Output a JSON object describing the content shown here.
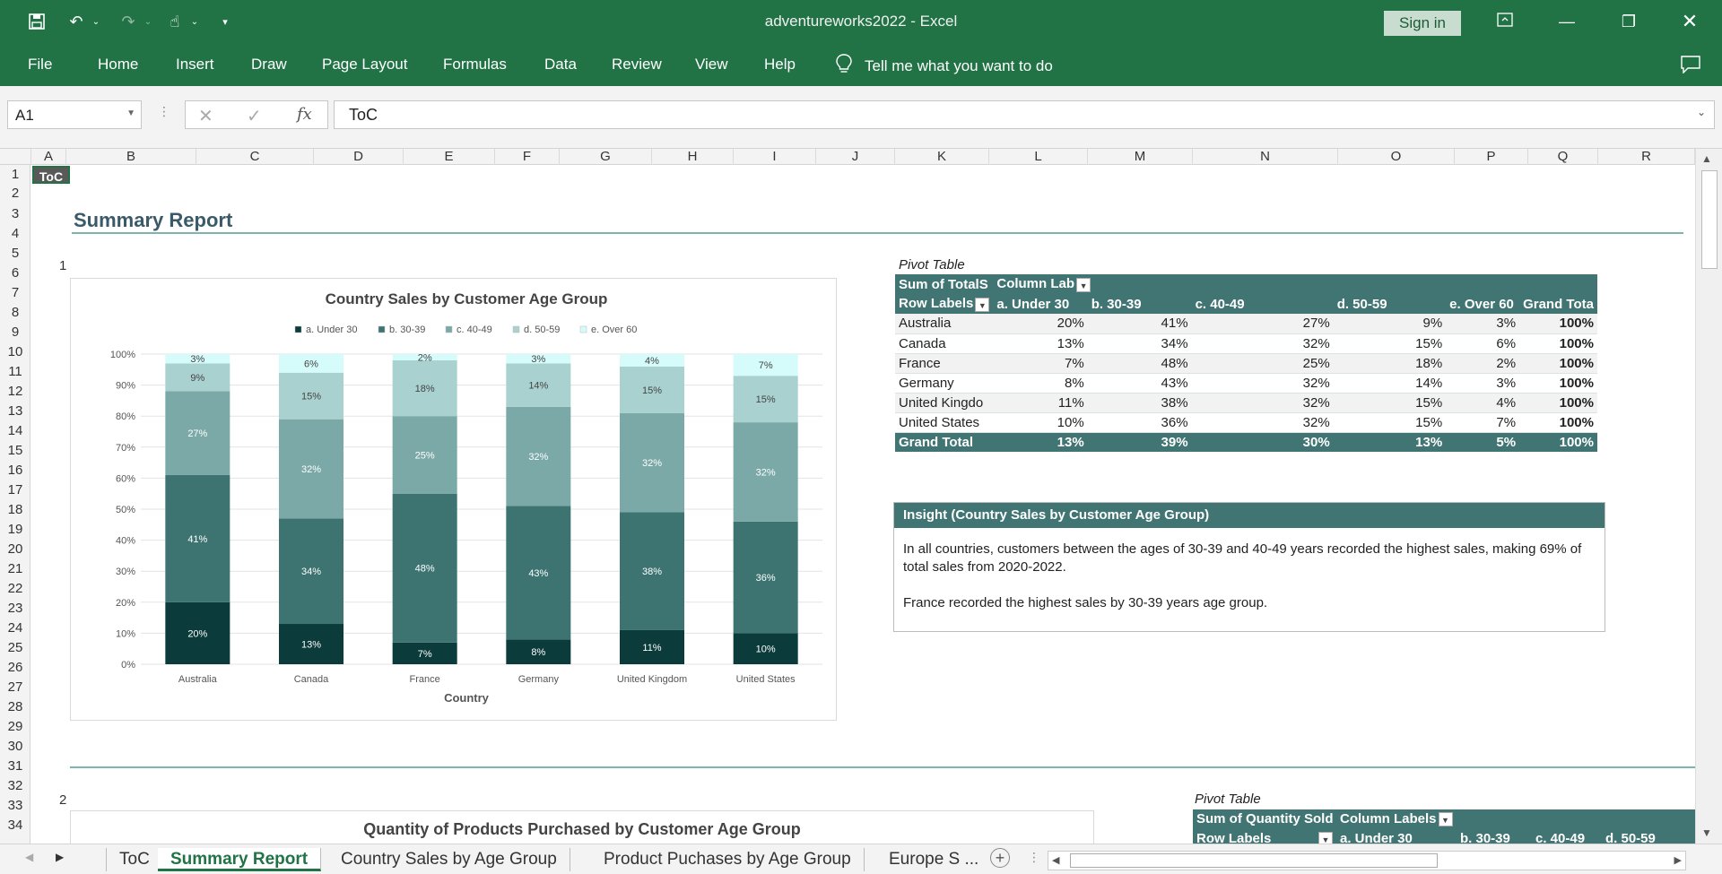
{
  "window": {
    "title": "adventureworks2022  -  Excel",
    "sign_in": "Sign in"
  },
  "ribbon": {
    "tabs": [
      "File",
      "Home",
      "Insert",
      "Draw",
      "Page Layout",
      "Formulas",
      "Data",
      "Review",
      "View",
      "Help"
    ],
    "tell_me": "Tell me what you want to do"
  },
  "formula_bar": {
    "name_box": "A1",
    "fx": "fx",
    "value": "ToC"
  },
  "columns": [
    "A",
    "B",
    "C",
    "D",
    "E",
    "F",
    "G",
    "H",
    "I",
    "J",
    "K",
    "L",
    "M",
    "N",
    "O",
    "P",
    "Q",
    "R"
  ],
  "rows": [
    1,
    2,
    3,
    4,
    5,
    6,
    7,
    8,
    9,
    10,
    11,
    12,
    13,
    14,
    15,
    16,
    17,
    18,
    19,
    20,
    21,
    22,
    23,
    24,
    25,
    26,
    27,
    28,
    29,
    30,
    31,
    32,
    33,
    34
  ],
  "sheet": {
    "toc_cell": "ToC",
    "title": "Summary Report",
    "section1": "1",
    "section2": "2",
    "chart2_title": "Quantity of Products Purchased by Customer Age Group"
  },
  "chart_data": {
    "type": "bar",
    "stacked": true,
    "title": "Country Sales by Customer Age Group",
    "xlabel": "Country",
    "ylabel": "",
    "ylim": [
      0,
      100
    ],
    "yticks": [
      "0%",
      "10%",
      "20%",
      "30%",
      "40%",
      "50%",
      "60%",
      "70%",
      "80%",
      "90%",
      "100%"
    ],
    "legend_position": "top",
    "categories": [
      "Australia",
      "Canada",
      "France",
      "Germany",
      "United Kingdom",
      "United States"
    ],
    "series": [
      {
        "name": "a. Under 30",
        "color": "#0b3b3a",
        "values": [
          20,
          13,
          7,
          8,
          11,
          10
        ]
      },
      {
        "name": "b. 30-39",
        "color": "#3d7472",
        "values": [
          41,
          34,
          48,
          43,
          38,
          36
        ]
      },
      {
        "name": "c. 40-49",
        "color": "#7aa9a7",
        "values": [
          27,
          32,
          25,
          32,
          32,
          32
        ]
      },
      {
        "name": "d. 50-59",
        "color": "#a9d1cf",
        "values": [
          9,
          15,
          18,
          14,
          15,
          15
        ]
      },
      {
        "name": "e. Over 60",
        "color": "#d5fbfa",
        "values": [
          3,
          6,
          2,
          3,
          4,
          7
        ]
      }
    ]
  },
  "pivot1": {
    "caption": "Pivot Table",
    "header1": [
      "Sum of  TotalS",
      "Column Lab"
    ],
    "header2": [
      "Row Labels",
      "a. Under 30",
      "b. 30-39",
      "c. 40-49",
      "d. 50-59",
      "e. Over 60",
      "Grand Tota"
    ],
    "rows": [
      [
        "Australia",
        "20%",
        "41%",
        "27%",
        "9%",
        "3%",
        "100%"
      ],
      [
        "Canada",
        "13%",
        "34%",
        "32%",
        "15%",
        "6%",
        "100%"
      ],
      [
        "France",
        "7%",
        "48%",
        "25%",
        "18%",
        "2%",
        "100%"
      ],
      [
        "Germany",
        "8%",
        "43%",
        "32%",
        "14%",
        "3%",
        "100%"
      ],
      [
        "United Kingdo",
        "11%",
        "38%",
        "32%",
        "15%",
        "4%",
        "100%"
      ],
      [
        "United States",
        "10%",
        "36%",
        "32%",
        "15%",
        "7%",
        "100%"
      ]
    ],
    "total": [
      "Grand Total",
      "13%",
      "39%",
      "30%",
      "13%",
      "5%",
      "100%"
    ]
  },
  "insight": {
    "title": "Insight (Country Sales by Customer Age Group)",
    "p1": "In all countries, customers between the ages of 30-39 and 40-49 years recorded the highest sales, making 69% of total sales from 2020-2022.",
    "p2": "France recorded the highest sales by 30-39 years age group."
  },
  "pivot2": {
    "caption": "Pivot Table",
    "header1": [
      "Sum of Quantity Sold",
      "Column Labels"
    ],
    "header2": [
      "Row Labels",
      "a. Under 30",
      "b. 30-39",
      "c. 40-49",
      "d. 50-59"
    ]
  },
  "sheet_tabs": [
    "ToC",
    "Summary Report",
    "Country Sales by Age Group",
    "Product Puchases by Age Group",
    "Europe S ..."
  ],
  "active_tab": "Summary Report"
}
